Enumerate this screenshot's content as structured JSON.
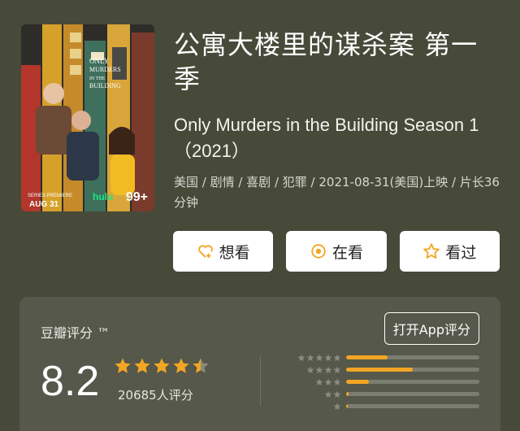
{
  "poster": {
    "badge": "99+"
  },
  "title": "公寓大楼里的谋杀案 第一季",
  "subtitle": "Only Murders in the Building Season 1（2021）",
  "meta": "美国 / 剧情 / 喜剧 / 犯罪 / 2021-08-31(美国)上映 / 片长36分钟",
  "actions": [
    {
      "label": "想看",
      "icon": "heart-plus-icon"
    },
    {
      "label": "在看",
      "icon": "target-icon"
    },
    {
      "label": "看过",
      "icon": "star-outline-icon"
    }
  ],
  "rating": {
    "label": "豆瓣评分 ™",
    "open_app": "打开App评分",
    "score": "8.2",
    "stars_filled": 4.5,
    "count": "20685人评分",
    "distribution": [
      {
        "stars": 5,
        "fraction": 0.31
      },
      {
        "stars": 4,
        "fraction": 0.5
      },
      {
        "stars": 3,
        "fraction": 0.17
      },
      {
        "stars": 2,
        "fraction": 0.02
      },
      {
        "stars": 1,
        "fraction": 0.01
      }
    ]
  },
  "colors": {
    "background": "#474a39",
    "card": "#55584a",
    "star": "#f3a624",
    "star_empty": "#8a8b80"
  }
}
